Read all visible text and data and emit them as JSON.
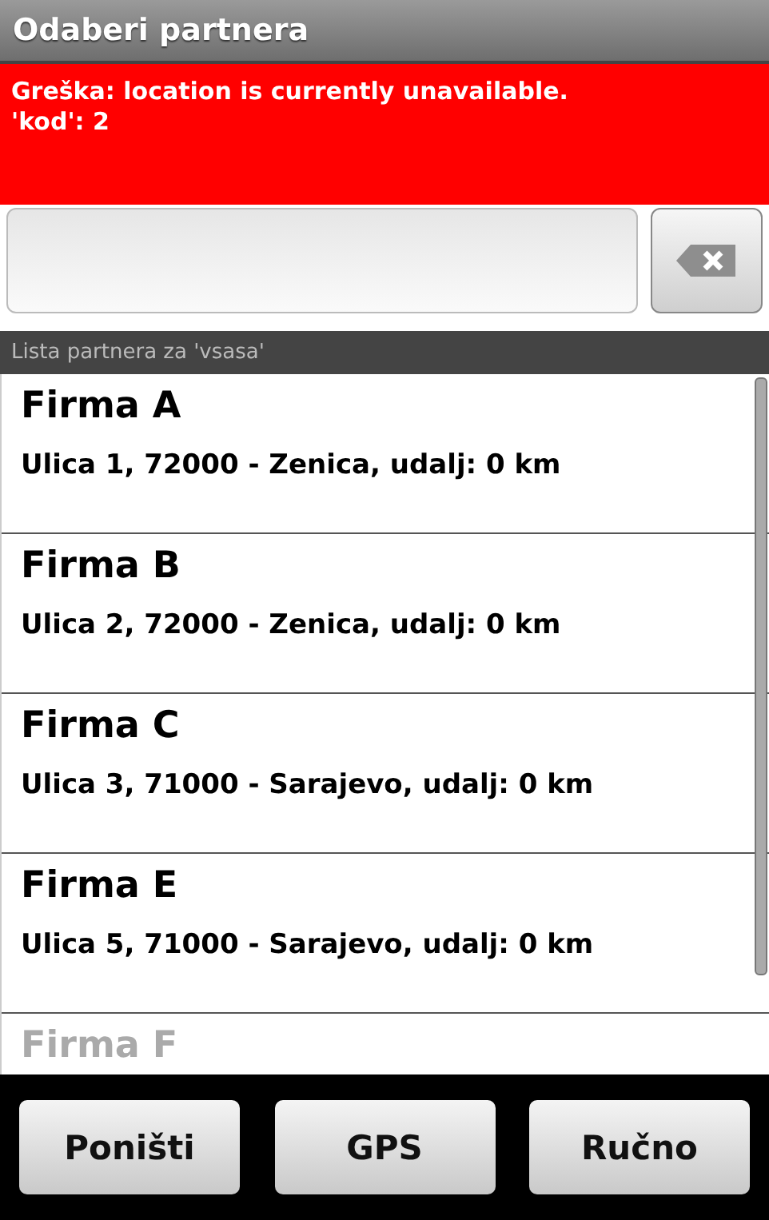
{
  "window": {
    "title": "Odaberi partnera"
  },
  "error": {
    "lines": [
      "Greška: location is currently unavailable.",
      "'kod': 2"
    ]
  },
  "list": {
    "header": "Lista partnera za 'vsasa'",
    "items": [
      {
        "name": "Firma A",
        "address": "Ulica 1, 72000 - Zenica, udalj: 0 km"
      },
      {
        "name": "Firma B",
        "address": "Ulica 2, 72000 - Zenica, udalj: 0 km"
      },
      {
        "name": "Firma C",
        "address": "Ulica 3, 71000 - Sarajevo, udalj: 0 km"
      },
      {
        "name": "Firma E",
        "address": "Ulica 5, 71000 - Sarajevo, udalj: 0 km"
      },
      {
        "name": "Firma F"
      }
    ]
  },
  "buttons": [
    "Poništi",
    "GPS",
    "Ručno"
  ]
}
